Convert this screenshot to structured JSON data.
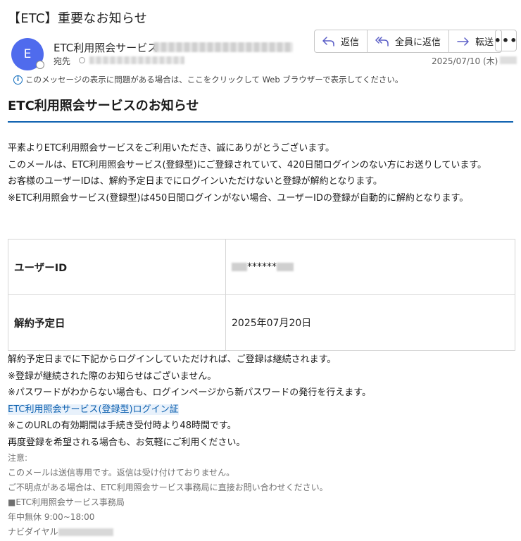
{
  "subject": "【ETC】重要なお知らせ",
  "sender": {
    "initial": "E",
    "name": "ETC利用照会サービス"
  },
  "to_label": "宛先",
  "actions": {
    "reply": "返信",
    "reply_all": "全員に返信",
    "forward": "転送",
    "more": "•••"
  },
  "date": "2025/07/10 (木)",
  "info_bar": "このメッセージの表示に問題がある場合は、ここをクリックして Web ブラウザーで表示してください。",
  "heading": "ETC利用照会サービスのお知らせ",
  "intro": [
    "平素よりETC利用照会サービスをご利用いただき、誠にありがとうございます。",
    "このメールは、ETC利用照会サービス(登録型)にご登録されていて、420日間ログインのない方にお送りしています。",
    "お客様のユーザーIDは、解約予定日までにログインいただけないと登録が解約となります。",
    "※ETC利用照会サービス(登録型)は450日間ログインがない場合、ユーザーIDの登録が自動的に解約となります。"
  ],
  "table": {
    "user_id_label": "ユーザーID",
    "user_id_value": "******",
    "cancel_date_label": "解約予定日",
    "cancel_date_value": "2025年07月20日"
  },
  "body": [
    "解約予定日までに下記からログインしていただければ、ご登録は継続されます。",
    "※登録が継続された際のお知らせはございません。",
    "※パスワードがわからない場合も、ログインページから新パスワードの発行を行えます。"
  ],
  "login_link": "ETC利用照会サービス(登録型)ログイン証",
  "body_after": [
    "※このURLの有効期間は手続き受付時より48時間です。",
    "再度登録を希望される場合も、お気軽にご利用ください。"
  ],
  "footer": {
    "note": "注意:",
    "line1": "このメールは送信専用です。返信は受け付けておりません。",
    "line2": "ご不明点がある場合は、ETC利用照会サービス事務局に直接お問い合わせください。",
    "office": "■ETC利用照会サービス事務局",
    "hours": "年中無休 9:00~18:00",
    "dial_label": "ナビダイヤル"
  },
  "colors": {
    "avatar": "#4f6bed",
    "accent": "#0f62b0",
    "link_bg": "#e8f1fb"
  }
}
